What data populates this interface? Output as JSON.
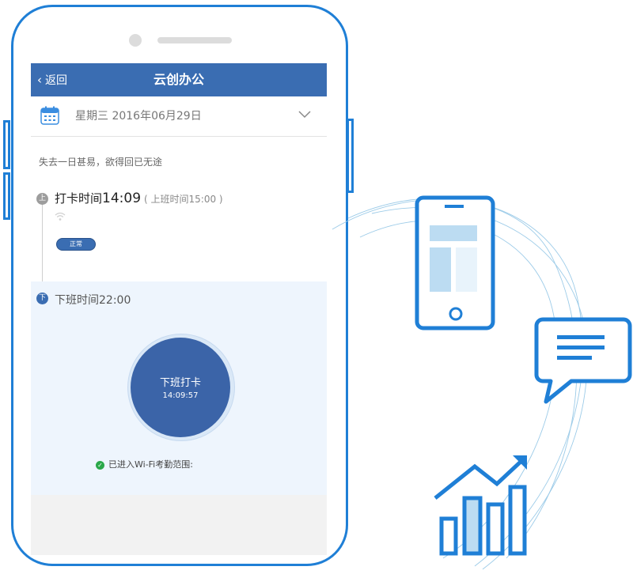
{
  "nav": {
    "back_label": "返回",
    "title": "云创办公"
  },
  "date_row": {
    "date_text": "星期三 2016年06月29日"
  },
  "motto": "失去一日甚易，欲得回已无途",
  "punch_in": {
    "label": "打卡时间",
    "time": "14:09",
    "scheduled": "( 上班时间15:00 )",
    "status": "正常",
    "dot_char": "上"
  },
  "punch_out": {
    "label": "下班时间22:00",
    "dot_char": "下",
    "button_label": "下班打卡",
    "button_time": "14:09:57"
  },
  "wifi_status": "已进入Wi-Fi考勤范围:",
  "colors": {
    "accent": "#1f7fd6",
    "nav": "#3a6db2",
    "punch_button": "#3b64a8",
    "success": "#2aa84a"
  },
  "icons": [
    "calendar-icon",
    "chevron-down-icon",
    "wifi-icon",
    "check-icon",
    "phone-icon",
    "chat-icon",
    "chart-icon"
  ]
}
